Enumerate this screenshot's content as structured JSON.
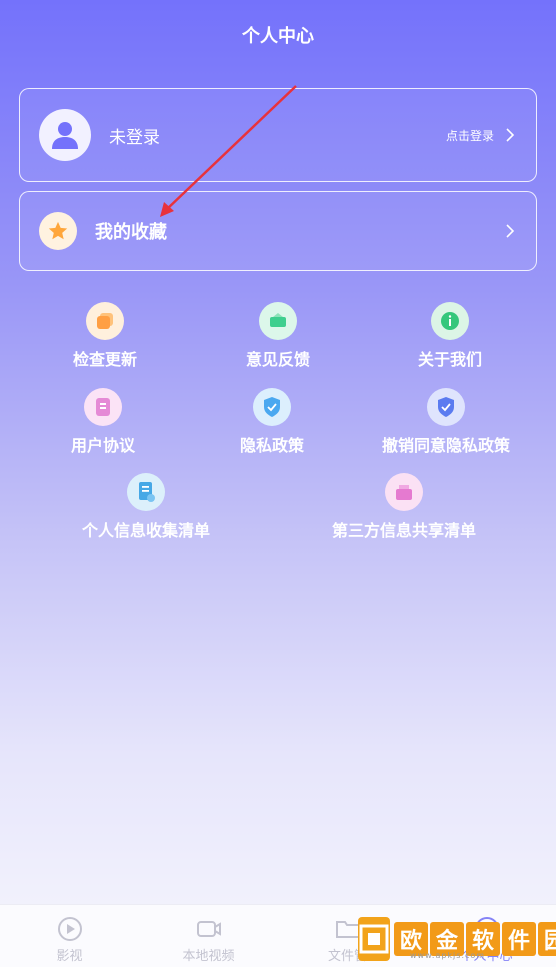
{
  "header": {
    "title": "个人中心"
  },
  "login_card": {
    "label": "未登录",
    "action": "点击登录"
  },
  "favorites_card": {
    "label": "我的收藏"
  },
  "menu": [
    {
      "label": "检查更新",
      "icon": "update-icon",
      "color": "#ff9f43"
    },
    {
      "label": "意见反馈",
      "icon": "feedback-icon",
      "color": "#3ecf8e"
    },
    {
      "label": "关于我们",
      "icon": "info-icon",
      "color": "#34c77b"
    },
    {
      "label": "用户协议",
      "icon": "agreement-icon",
      "color": "#e58ad6"
    },
    {
      "label": "隐私政策",
      "icon": "privacy-shield-icon",
      "color": "#4aa8f0"
    },
    {
      "label": "撤销同意隐私政策",
      "icon": "revoke-shield-icon",
      "color": "#5b7bf0"
    },
    {
      "label": "个人信息收集清单",
      "icon": "info-list-icon",
      "color": "#46a8e6"
    },
    {
      "label": "第三方信息共享清单",
      "icon": "share-list-icon",
      "color": "#e57ad0"
    }
  ],
  "tabs": [
    {
      "label": "影视",
      "icon": "play-circle-icon"
    },
    {
      "label": "本地视频",
      "icon": "video-icon"
    },
    {
      "label": "文件管",
      "icon": "folder-icon"
    },
    {
      "label": "个人中心",
      "icon": "person-icon"
    }
  ],
  "watermark": {
    "chars": [
      "欧",
      "金",
      "软",
      "件",
      "园"
    ],
    "url": "www.apkjs.com"
  },
  "colors": {
    "accent": "#7472fb",
    "arrow": "#e8323c"
  }
}
